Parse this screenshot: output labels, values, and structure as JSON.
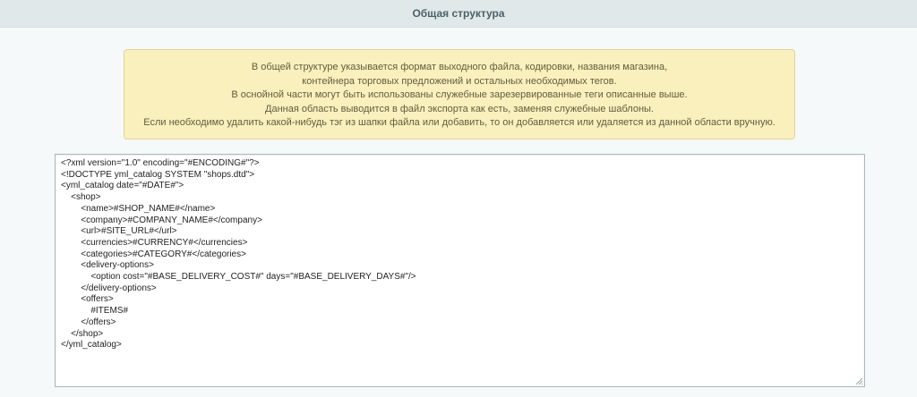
{
  "header": {
    "title": "Общая структура"
  },
  "notice": {
    "lines": [
      "В общей структуре указывается формат выходного файла, кодировки, названия магазина,",
      "контейнера торговых предложений и остальных необходимых тегов.",
      "В оснойной части могут быть использованы служебные зарезервированные теги описанные выше.",
      "Данная область выводится в файл экспорта как есть, заменяя служебные шаблоны.",
      "Если необходимо удалить какой-нибудь тэг из шапки файла или добавить, то он добавляется или удаляется из данной области вручную."
    ]
  },
  "editor": {
    "value": "<?xml version=\"1.0\" encoding=\"#ENCODING#\"?>\n<!DOCTYPE yml_catalog SYSTEM \"shops.dtd\">\n<yml_catalog date=\"#DATE#\">\n    <shop>\n        <name>#SHOP_NAME#</name>\n        <company>#COMPANY_NAME#</company>\n        <url>#SITE_URL#</url>\n        <currencies>#CURRENCY#</currencies>\n        <categories>#CATEGORY#</categories>\n        <delivery-options>\n            <option cost=\"#BASE_DELIVERY_COST#\" days=\"#BASE_DELIVERY_DAYS#\"/>\n        </delivery-options>\n        <offers>\n            #ITEMS#\n        </offers>\n    </shop>\n</yml_catalog>"
  },
  "icons": {
    "resize_grip": "resize-grip-icon"
  }
}
